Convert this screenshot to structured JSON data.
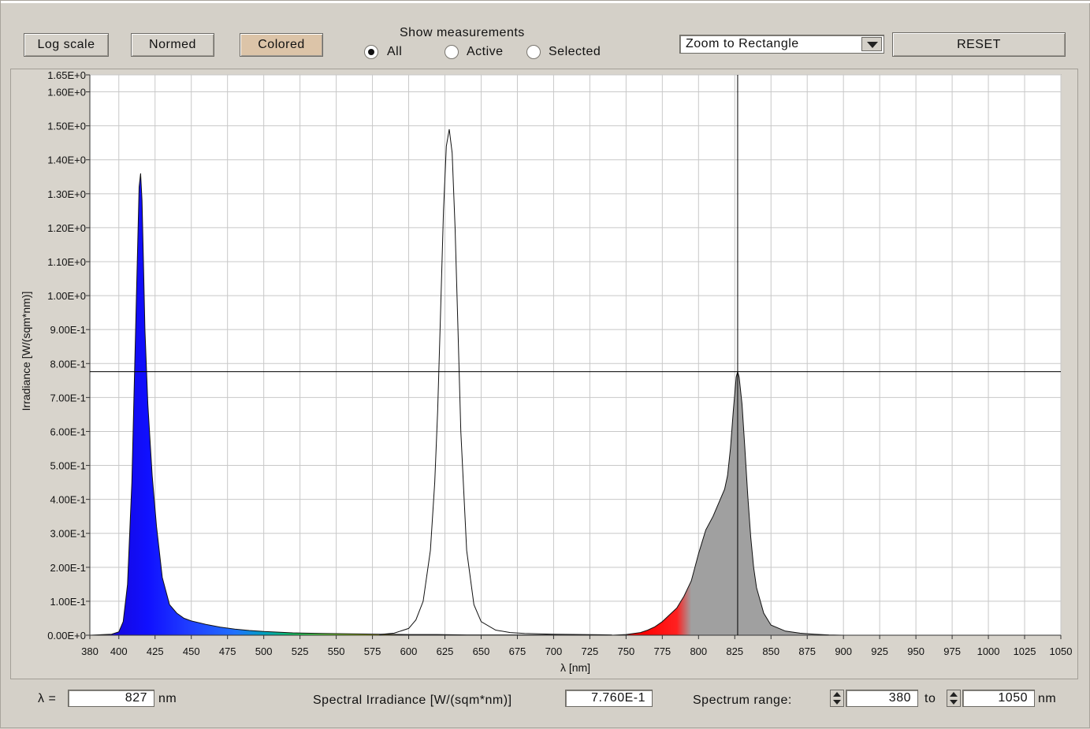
{
  "toolbar": {
    "log_scale_label": "Log scale",
    "normed_label": "Normed",
    "colored_label": "Colored",
    "show_measurements_label": "Show measurements",
    "radio_all": "All",
    "radio_active": "Active",
    "radio_selected": "Selected",
    "selected_radio": "All",
    "zoom_mode": "Zoom to Rectangle",
    "reset_label": "RESET"
  },
  "chart_data": {
    "type": "area",
    "xlabel": "λ [nm]",
    "ylabel": "Irradiance [W/(sqm*nm)]",
    "xlim": [
      380,
      1050
    ],
    "ylim": [
      0,
      1.65
    ],
    "grid": true,
    "x_ticks": [
      "380",
      "400",
      "425",
      "450",
      "475",
      "500",
      "525",
      "550",
      "575",
      "600",
      "625",
      "650",
      "675",
      "700",
      "725",
      "750",
      "775",
      "800",
      "825",
      "850",
      "875",
      "900",
      "925",
      "950",
      "975",
      "1000",
      "1025",
      "1050"
    ],
    "y_ticks": [
      "0.00E+0",
      "1.00E-1",
      "2.00E-1",
      "3.00E-1",
      "4.00E-1",
      "5.00E-1",
      "6.00E-1",
      "7.00E-1",
      "8.00E-1",
      "9.00E-1",
      "1.00E+0",
      "1.10E+0",
      "1.20E+0",
      "1.30E+0",
      "1.40E+0",
      "1.50E+0",
      "1.60E+0",
      "1.65E+0"
    ],
    "series": [
      {
        "x": [
          380,
          395,
          400,
          403,
          406,
          409,
          411,
          413,
          414,
          415,
          416,
          417,
          418,
          420,
          423,
          426,
          430,
          435,
          440,
          445,
          450,
          460,
          470,
          480,
          490,
          500,
          520,
          540,
          560,
          580,
          600,
          620,
          640,
          660,
          680,
          700,
          720,
          740,
          760,
          780,
          800,
          820,
          840,
          860,
          880,
          900
        ],
        "y": [
          0,
          0.003,
          0.01,
          0.04,
          0.15,
          0.45,
          0.8,
          1.15,
          1.32,
          1.36,
          1.28,
          1.1,
          0.9,
          0.68,
          0.47,
          0.32,
          0.17,
          0.09,
          0.065,
          0.05,
          0.042,
          0.032,
          0.024,
          0.018,
          0.014,
          0.011,
          0.007,
          0.005,
          0.004,
          0.003,
          0.002,
          0.002,
          0.001,
          0.001,
          0.001,
          0.001,
          0,
          0,
          0,
          0,
          0,
          0,
          0,
          0,
          0,
          0
        ],
        "color_mode": "spectrum"
      },
      {
        "x": [
          580,
          590,
          600,
          605,
          610,
          615,
          618,
          620,
          622,
          624,
          626,
          628,
          630,
          632,
          634,
          636,
          640,
          645,
          650,
          660,
          670,
          680,
          700,
          720,
          740
        ],
        "y": [
          0.002,
          0.006,
          0.02,
          0.045,
          0.1,
          0.25,
          0.45,
          0.66,
          0.95,
          1.25,
          1.44,
          1.49,
          1.42,
          1.2,
          0.9,
          0.6,
          0.25,
          0.09,
          0.04,
          0.015,
          0.008,
          0.005,
          0.003,
          0.002,
          0.001
        ],
        "color_mode": "outline"
      },
      {
        "x": [
          740,
          750,
          760,
          765,
          770,
          775,
          780,
          785,
          790,
          795,
          800,
          805,
          810,
          815,
          818,
          820,
          822,
          824,
          826,
          827,
          828,
          830,
          832,
          834,
          836,
          838,
          840,
          845,
          850,
          860,
          870,
          880,
          890,
          900
        ],
        "y": [
          0,
          0.002,
          0.008,
          0.015,
          0.025,
          0.04,
          0.06,
          0.08,
          0.115,
          0.16,
          0.24,
          0.31,
          0.35,
          0.4,
          0.43,
          0.47,
          0.55,
          0.66,
          0.76,
          0.776,
          0.76,
          0.68,
          0.55,
          0.41,
          0.29,
          0.2,
          0.14,
          0.065,
          0.03,
          0.012,
          0.006,
          0.003,
          0.001,
          0
        ],
        "color_mode": "spectrum"
      }
    ],
    "cursor": {
      "x": 827,
      "y": 0.776
    }
  },
  "status": {
    "lambda_label": "λ =",
    "lambda_value": "827",
    "lambda_unit": "nm",
    "irradiance_label": "Spectral Irradiance [W/(sqm*nm)]",
    "irradiance_value": "7.760E-1",
    "range_label": "Spectrum range:",
    "range_from": "380",
    "range_to_label": "to",
    "range_to": "1050",
    "range_unit": "nm"
  }
}
